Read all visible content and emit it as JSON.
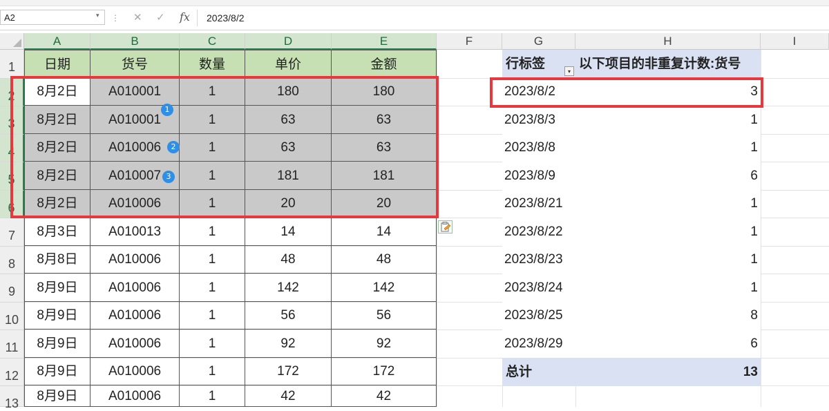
{
  "formula_bar": {
    "name_box": "A2",
    "formula": "2023/8/2",
    "fx_label": "fx"
  },
  "columns": [
    "A",
    "B",
    "C",
    "D",
    "E",
    "F",
    "G",
    "H",
    "I"
  ],
  "rows": [
    "1",
    "2",
    "3",
    "4",
    "5",
    "6",
    "7",
    "8",
    "9",
    "10",
    "11",
    "12",
    "13"
  ],
  "source_headers": [
    "日期",
    "货号",
    "数量",
    "单价",
    "金额"
  ],
  "source_rows": [
    [
      "8月2日",
      "A010001",
      "1",
      "180",
      "180"
    ],
    [
      "8月2日",
      "A010001",
      "1",
      "63",
      "63"
    ],
    [
      "8月2日",
      "A010006",
      "1",
      "63",
      "63"
    ],
    [
      "8月2日",
      "A010007",
      "1",
      "181",
      "181"
    ],
    [
      "8月2日",
      "A010006",
      "1",
      "20",
      "20"
    ],
    [
      "8月3日",
      "A010013",
      "1",
      "14",
      "14"
    ],
    [
      "8月8日",
      "A010006",
      "1",
      "48",
      "48"
    ],
    [
      "8月9日",
      "A010006",
      "1",
      "142",
      "142"
    ],
    [
      "8月9日",
      "A010006",
      "1",
      "56",
      "56"
    ],
    [
      "8月9日",
      "A010006",
      "1",
      "92",
      "92"
    ],
    [
      "8月9日",
      "A010006",
      "1",
      "172",
      "172"
    ],
    [
      "8月9日",
      "A010006",
      "1",
      "42",
      "42"
    ]
  ],
  "pivot": {
    "row_label": "行标签",
    "value_label": "以下项目的非重复计数:货号",
    "rows": [
      [
        "2023/8/2",
        "3"
      ],
      [
        "2023/8/3",
        "1"
      ],
      [
        "2023/8/8",
        "1"
      ],
      [
        "2023/8/9",
        "6"
      ],
      [
        "2023/8/21",
        "1"
      ],
      [
        "2023/8/22",
        "1"
      ],
      [
        "2023/8/23",
        "1"
      ],
      [
        "2023/8/24",
        "1"
      ],
      [
        "2023/8/25",
        "8"
      ],
      [
        "2023/8/29",
        "6"
      ]
    ],
    "total_label": "总计",
    "total_value": "13"
  },
  "badges": [
    "1",
    "2",
    "3"
  ],
  "colors": {
    "header_green": "#c6e0b4",
    "pivot_blue": "#d9e1f2",
    "selection_gray": "#c9c9c9",
    "highlight_red": "#e8383d",
    "badge_blue": "#2f8fe6"
  }
}
